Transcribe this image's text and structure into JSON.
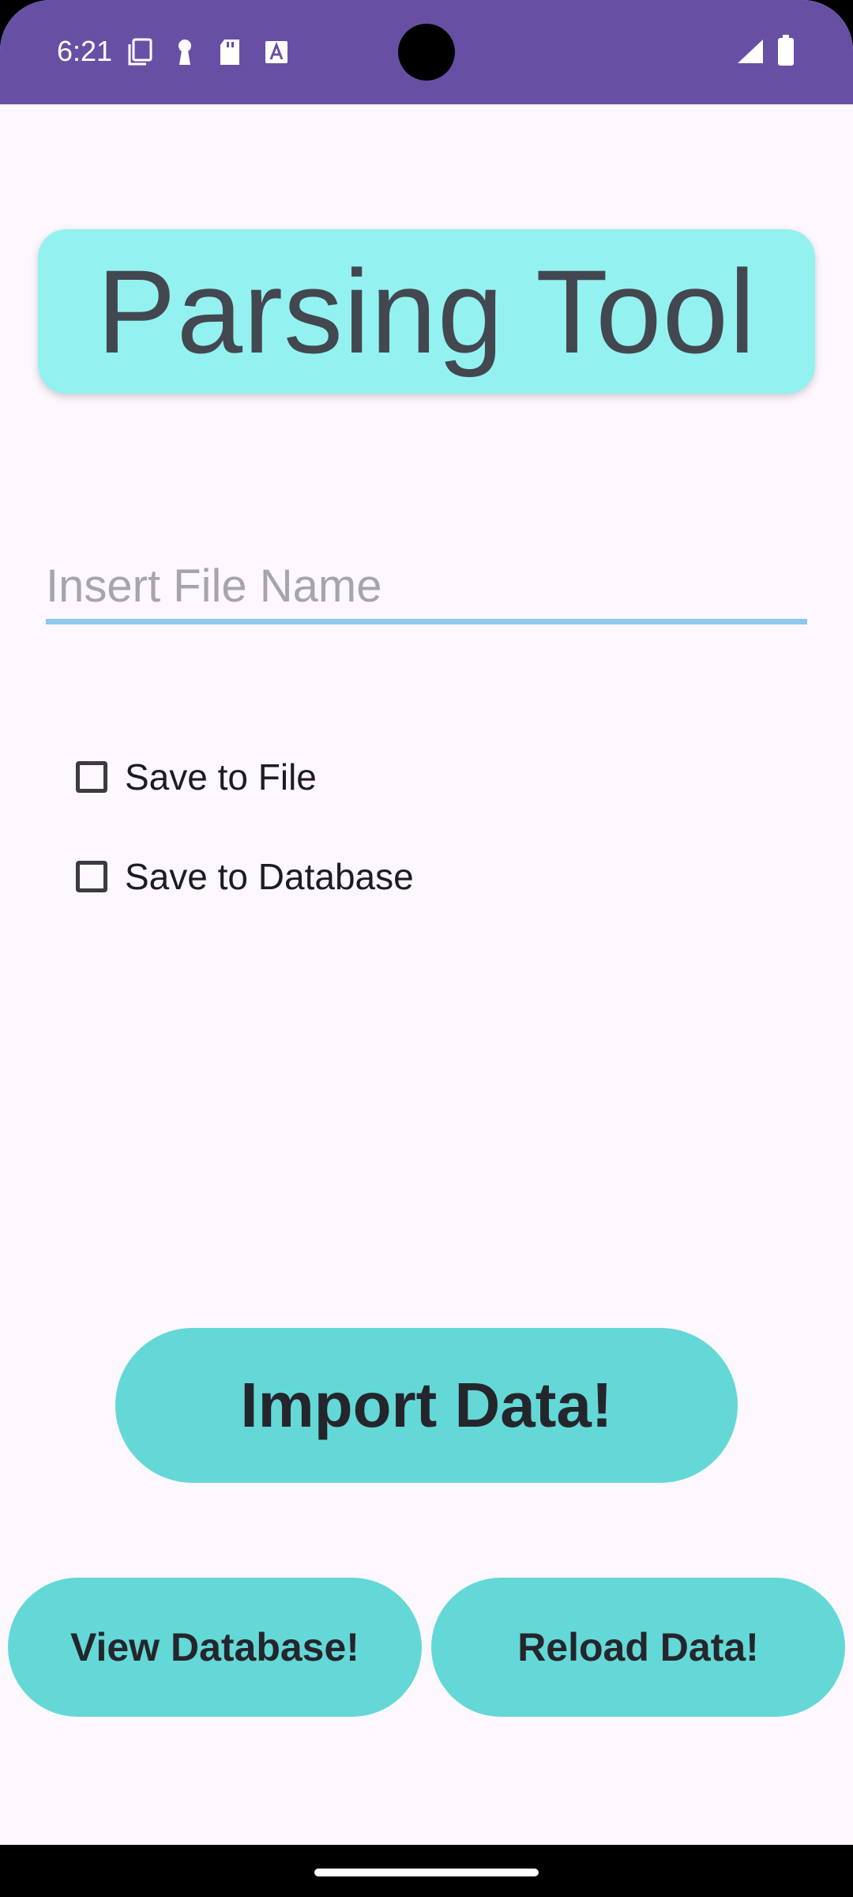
{
  "status_bar": {
    "time": "6:21",
    "left_icons": [
      "copy-icon",
      "keyhole-icon",
      "sd-card-icon",
      "font-a-icon"
    ],
    "right_icons": [
      "signal-icon",
      "battery-icon"
    ],
    "color": "#6750A4"
  },
  "app": {
    "title": "Parsing Tool",
    "file_input": {
      "placeholder": "Insert File Name",
      "value": ""
    },
    "options": {
      "save_to_file": {
        "label": "Save to File",
        "checked": false
      },
      "save_to_database": {
        "label": "Save to Database",
        "checked": false
      }
    },
    "buttons": {
      "import": "Import Data!",
      "view_database": "View Database!",
      "reload": "Reload Data!"
    },
    "colors": {
      "background": "#FDF7FE",
      "title_card": "#93F2EF",
      "button": "#64D8D7",
      "input_underline": "#8CC7EF"
    }
  }
}
